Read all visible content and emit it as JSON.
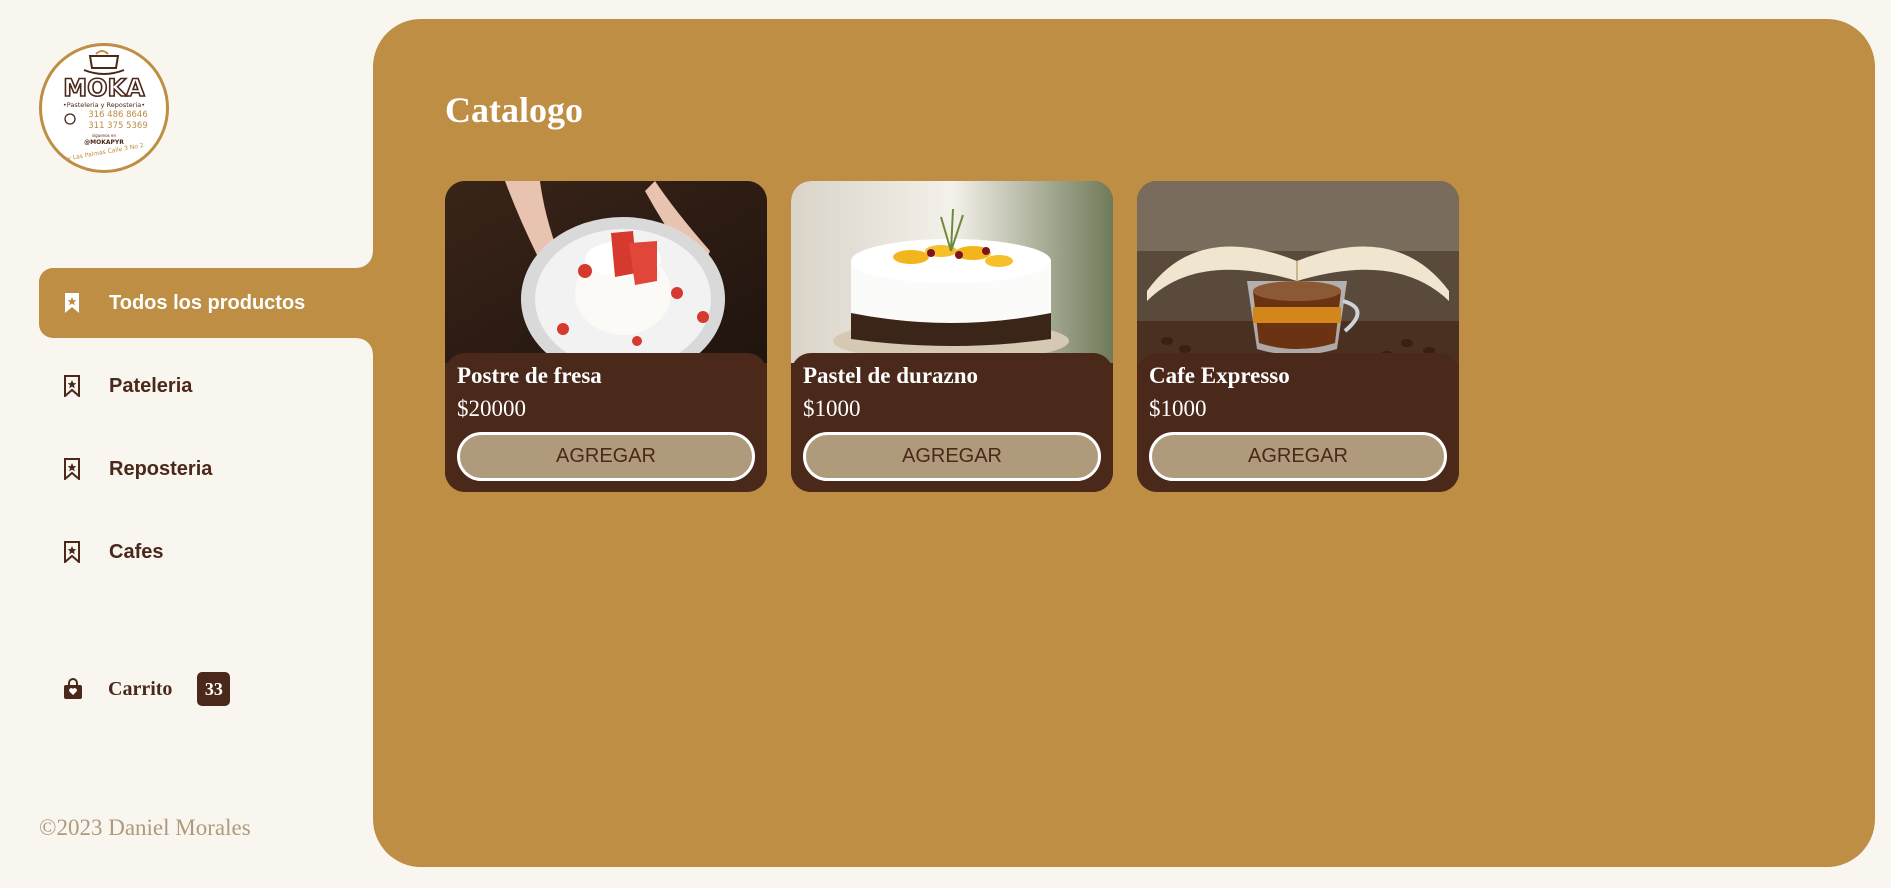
{
  "logo": {
    "name": "MOKA",
    "tagline": "•Pasteleria y Reposteria•",
    "phone1": "316 486 8646",
    "phone2": "311 375 5369",
    "follow": "siguenos en",
    "handle": "@MOKAPYR",
    "address": "Av Las Palmas Calle 3 No 2"
  },
  "nav": {
    "items": [
      {
        "label": "Todos los productos",
        "icon": "bookmark-filled-icon",
        "active": true
      },
      {
        "label": "Pateleria",
        "icon": "bookmark-icon",
        "active": false
      },
      {
        "label": "Reposteria",
        "icon": "bookmark-icon",
        "active": false
      },
      {
        "label": "Cafes",
        "icon": "bookmark-icon",
        "active": false
      }
    ]
  },
  "cart": {
    "label": "Carrito",
    "count": "33",
    "icon": "shopping-bag-icon"
  },
  "footer": {
    "copyright": "©2023 Daniel Morales"
  },
  "main": {
    "title": "Catalogo",
    "products": [
      {
        "name": "Postre de fresa",
        "price": "$20000",
        "button": "AGREGAR"
      },
      {
        "name": "Pastel de durazno",
        "price": "$1000",
        "button": "AGREGAR"
      },
      {
        "name": "Cafe Expresso",
        "price": "$1000",
        "button": "AGREGAR"
      }
    ]
  },
  "colors": {
    "background": "#f8f6ef",
    "accent": "#bd8e43",
    "dark": "#4a281a",
    "button": "#b09a7c"
  }
}
